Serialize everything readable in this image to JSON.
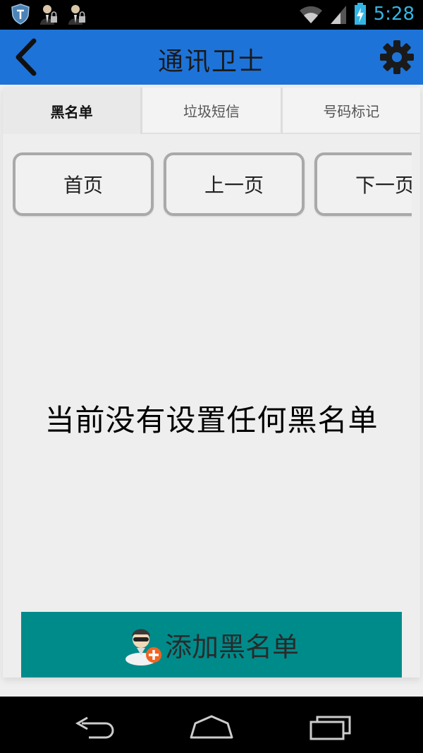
{
  "status_bar": {
    "time": "5:28",
    "icons": [
      "shield-icon",
      "user-lock-icon",
      "user-lock-icon",
      "wifi-icon",
      "signal-icon",
      "battery-charging-icon"
    ],
    "accent": "#33b5e5"
  },
  "app_bar": {
    "title": "通讯卫士",
    "back_icon": "chevron-left-icon",
    "settings_icon": "gear-icon",
    "color": "#1e73d8"
  },
  "tabs": [
    {
      "label": "黑名单",
      "active": true
    },
    {
      "label": "垃圾短信",
      "active": false
    },
    {
      "label": "号码标记",
      "active": false
    }
  ],
  "pager": {
    "first": "首页",
    "prev": "上一页",
    "next": "下一页"
  },
  "empty_message": "当前没有设置任何黑名单",
  "add_button": {
    "label": "添加黑名单",
    "icon": "add-contact-icon",
    "color": "#008b8b"
  },
  "nav_bar": {
    "icons": [
      "back-icon",
      "home-icon",
      "recents-icon"
    ]
  }
}
